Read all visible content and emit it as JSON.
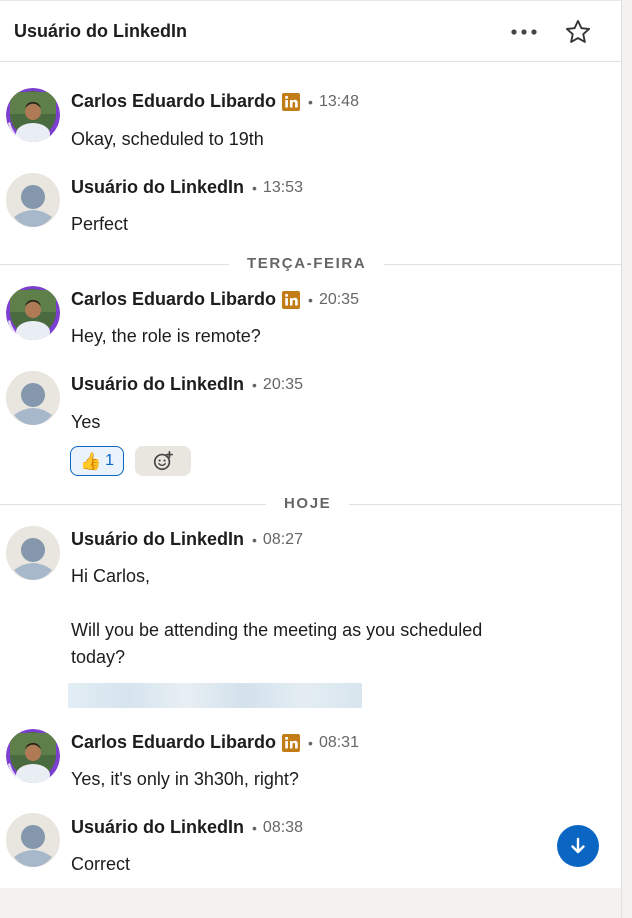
{
  "header": {
    "title": "Usuário do LinkedIn",
    "more_icon": "ellipsis-icon",
    "star_icon": "star-outline-icon"
  },
  "messages": [
    {
      "sender": "Carlos Eduardo Libardo",
      "time": "13:48",
      "text": "Okay, scheduled to 19th",
      "badge": "linkedin-premium-icon"
    },
    {
      "sender": "Usuário do LinkedIn",
      "time": "13:53",
      "text": "Perfect"
    },
    {
      "sender": "Carlos Eduardo Libardo",
      "time": "20:35",
      "text": "Hey, the role is remote?",
      "badge": "linkedin-premium-icon"
    },
    {
      "sender": "Usuário do LinkedIn",
      "time": "20:35",
      "text": "Yes"
    },
    {
      "sender": "Usuário do LinkedIn",
      "time": "08:27",
      "line1": "Hi Carlos,",
      "line2": "Will you be attending the meeting as you scheduled",
      "line3": "today?"
    },
    {
      "sender": "Carlos Eduardo Libardo",
      "time": "08:31",
      "text": "Yes, it's only in 3h30h, right?",
      "badge": "linkedin-premium-icon"
    },
    {
      "sender": "Usuário do LinkedIn",
      "time": "08:38",
      "text": "Correct"
    }
  ],
  "dividers": {
    "tuesday": "TERÇA-FEIRA",
    "today": "HOJE"
  },
  "reactions": {
    "thumbs_count": "1",
    "thumbs_icon": "thumbs-up-emoji",
    "add_icon": "add-reaction-icon"
  },
  "dot": "•",
  "colors": {
    "accent": "#0a66c2",
    "badge_gold": "#c37d16",
    "avatar_ring": "#7c3fd1"
  }
}
